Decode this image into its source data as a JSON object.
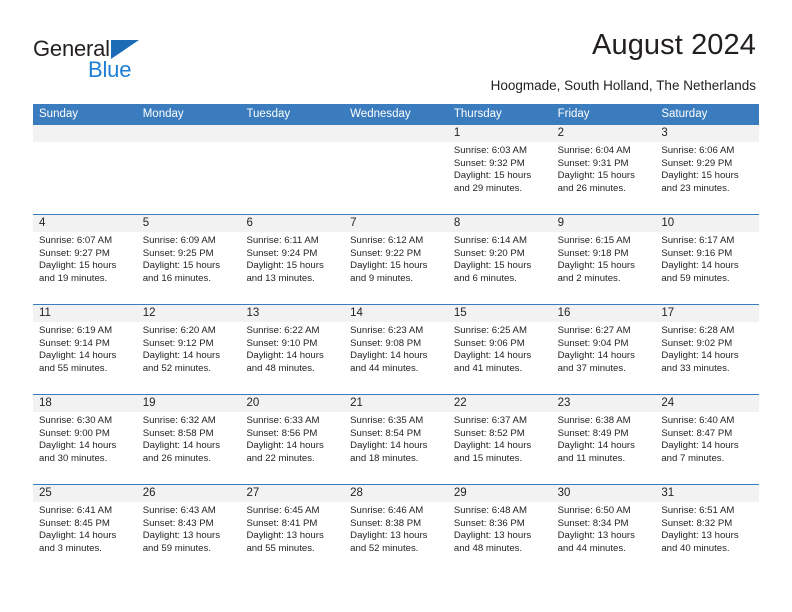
{
  "brand": {
    "name_part1": "General",
    "name_part2": "Blue",
    "accent_color": "#1b7fd4",
    "triangle_color": "#1b6cb5"
  },
  "header": {
    "title": "August 2024",
    "subtitle": "Hoogmade, South Holland, The Netherlands",
    "header_bg_color": "#3a7cbe",
    "day_band_color": "#f2f2f2"
  },
  "weekdays": [
    "Sunday",
    "Monday",
    "Tuesday",
    "Wednesday",
    "Thursday",
    "Friday",
    "Saturday"
  ],
  "weeks": [
    [
      {
        "number": "",
        "sunrise": "",
        "sunset": "",
        "daylight_line1": "",
        "daylight_line2": ""
      },
      {
        "number": "",
        "sunrise": "",
        "sunset": "",
        "daylight_line1": "",
        "daylight_line2": ""
      },
      {
        "number": "",
        "sunrise": "",
        "sunset": "",
        "daylight_line1": "",
        "daylight_line2": ""
      },
      {
        "number": "",
        "sunrise": "",
        "sunset": "",
        "daylight_line1": "",
        "daylight_line2": ""
      },
      {
        "number": "1",
        "sunrise": "Sunrise: 6:03 AM",
        "sunset": "Sunset: 9:32 PM",
        "daylight_line1": "Daylight: 15 hours",
        "daylight_line2": "and 29 minutes."
      },
      {
        "number": "2",
        "sunrise": "Sunrise: 6:04 AM",
        "sunset": "Sunset: 9:31 PM",
        "daylight_line1": "Daylight: 15 hours",
        "daylight_line2": "and 26 minutes."
      },
      {
        "number": "3",
        "sunrise": "Sunrise: 6:06 AM",
        "sunset": "Sunset: 9:29 PM",
        "daylight_line1": "Daylight: 15 hours",
        "daylight_line2": "and 23 minutes."
      }
    ],
    [
      {
        "number": "4",
        "sunrise": "Sunrise: 6:07 AM",
        "sunset": "Sunset: 9:27 PM",
        "daylight_line1": "Daylight: 15 hours",
        "daylight_line2": "and 19 minutes."
      },
      {
        "number": "5",
        "sunrise": "Sunrise: 6:09 AM",
        "sunset": "Sunset: 9:25 PM",
        "daylight_line1": "Daylight: 15 hours",
        "daylight_line2": "and 16 minutes."
      },
      {
        "number": "6",
        "sunrise": "Sunrise: 6:11 AM",
        "sunset": "Sunset: 9:24 PM",
        "daylight_line1": "Daylight: 15 hours",
        "daylight_line2": "and 13 minutes."
      },
      {
        "number": "7",
        "sunrise": "Sunrise: 6:12 AM",
        "sunset": "Sunset: 9:22 PM",
        "daylight_line1": "Daylight: 15 hours",
        "daylight_line2": "and 9 minutes."
      },
      {
        "number": "8",
        "sunrise": "Sunrise: 6:14 AM",
        "sunset": "Sunset: 9:20 PM",
        "daylight_line1": "Daylight: 15 hours",
        "daylight_line2": "and 6 minutes."
      },
      {
        "number": "9",
        "sunrise": "Sunrise: 6:15 AM",
        "sunset": "Sunset: 9:18 PM",
        "daylight_line1": "Daylight: 15 hours",
        "daylight_line2": "and 2 minutes."
      },
      {
        "number": "10",
        "sunrise": "Sunrise: 6:17 AM",
        "sunset": "Sunset: 9:16 PM",
        "daylight_line1": "Daylight: 14 hours",
        "daylight_line2": "and 59 minutes."
      }
    ],
    [
      {
        "number": "11",
        "sunrise": "Sunrise: 6:19 AM",
        "sunset": "Sunset: 9:14 PM",
        "daylight_line1": "Daylight: 14 hours",
        "daylight_line2": "and 55 minutes."
      },
      {
        "number": "12",
        "sunrise": "Sunrise: 6:20 AM",
        "sunset": "Sunset: 9:12 PM",
        "daylight_line1": "Daylight: 14 hours",
        "daylight_line2": "and 52 minutes."
      },
      {
        "number": "13",
        "sunrise": "Sunrise: 6:22 AM",
        "sunset": "Sunset: 9:10 PM",
        "daylight_line1": "Daylight: 14 hours",
        "daylight_line2": "and 48 minutes."
      },
      {
        "number": "14",
        "sunrise": "Sunrise: 6:23 AM",
        "sunset": "Sunset: 9:08 PM",
        "daylight_line1": "Daylight: 14 hours",
        "daylight_line2": "and 44 minutes."
      },
      {
        "number": "15",
        "sunrise": "Sunrise: 6:25 AM",
        "sunset": "Sunset: 9:06 PM",
        "daylight_line1": "Daylight: 14 hours",
        "daylight_line2": "and 41 minutes."
      },
      {
        "number": "16",
        "sunrise": "Sunrise: 6:27 AM",
        "sunset": "Sunset: 9:04 PM",
        "daylight_line1": "Daylight: 14 hours",
        "daylight_line2": "and 37 minutes."
      },
      {
        "number": "17",
        "sunrise": "Sunrise: 6:28 AM",
        "sunset": "Sunset: 9:02 PM",
        "daylight_line1": "Daylight: 14 hours",
        "daylight_line2": "and 33 minutes."
      }
    ],
    [
      {
        "number": "18",
        "sunrise": "Sunrise: 6:30 AM",
        "sunset": "Sunset: 9:00 PM",
        "daylight_line1": "Daylight: 14 hours",
        "daylight_line2": "and 30 minutes."
      },
      {
        "number": "19",
        "sunrise": "Sunrise: 6:32 AM",
        "sunset": "Sunset: 8:58 PM",
        "daylight_line1": "Daylight: 14 hours",
        "daylight_line2": "and 26 minutes."
      },
      {
        "number": "20",
        "sunrise": "Sunrise: 6:33 AM",
        "sunset": "Sunset: 8:56 PM",
        "daylight_line1": "Daylight: 14 hours",
        "daylight_line2": "and 22 minutes."
      },
      {
        "number": "21",
        "sunrise": "Sunrise: 6:35 AM",
        "sunset": "Sunset: 8:54 PM",
        "daylight_line1": "Daylight: 14 hours",
        "daylight_line2": "and 18 minutes."
      },
      {
        "number": "22",
        "sunrise": "Sunrise: 6:37 AM",
        "sunset": "Sunset: 8:52 PM",
        "daylight_line1": "Daylight: 14 hours",
        "daylight_line2": "and 15 minutes."
      },
      {
        "number": "23",
        "sunrise": "Sunrise: 6:38 AM",
        "sunset": "Sunset: 8:49 PM",
        "daylight_line1": "Daylight: 14 hours",
        "daylight_line2": "and 11 minutes."
      },
      {
        "number": "24",
        "sunrise": "Sunrise: 6:40 AM",
        "sunset": "Sunset: 8:47 PM",
        "daylight_line1": "Daylight: 14 hours",
        "daylight_line2": "and 7 minutes."
      }
    ],
    [
      {
        "number": "25",
        "sunrise": "Sunrise: 6:41 AM",
        "sunset": "Sunset: 8:45 PM",
        "daylight_line1": "Daylight: 14 hours",
        "daylight_line2": "and 3 minutes."
      },
      {
        "number": "26",
        "sunrise": "Sunrise: 6:43 AM",
        "sunset": "Sunset: 8:43 PM",
        "daylight_line1": "Daylight: 13 hours",
        "daylight_line2": "and 59 minutes."
      },
      {
        "number": "27",
        "sunrise": "Sunrise: 6:45 AM",
        "sunset": "Sunset: 8:41 PM",
        "daylight_line1": "Daylight: 13 hours",
        "daylight_line2": "and 55 minutes."
      },
      {
        "number": "28",
        "sunrise": "Sunrise: 6:46 AM",
        "sunset": "Sunset: 8:38 PM",
        "daylight_line1": "Daylight: 13 hours",
        "daylight_line2": "and 52 minutes."
      },
      {
        "number": "29",
        "sunrise": "Sunrise: 6:48 AM",
        "sunset": "Sunset: 8:36 PM",
        "daylight_line1": "Daylight: 13 hours",
        "daylight_line2": "and 48 minutes."
      },
      {
        "number": "30",
        "sunrise": "Sunrise: 6:50 AM",
        "sunset": "Sunset: 8:34 PM",
        "daylight_line1": "Daylight: 13 hours",
        "daylight_line2": "and 44 minutes."
      },
      {
        "number": "31",
        "sunrise": "Sunrise: 6:51 AM",
        "sunset": "Sunset: 8:32 PM",
        "daylight_line1": "Daylight: 13 hours",
        "daylight_line2": "and 40 minutes."
      }
    ]
  ]
}
